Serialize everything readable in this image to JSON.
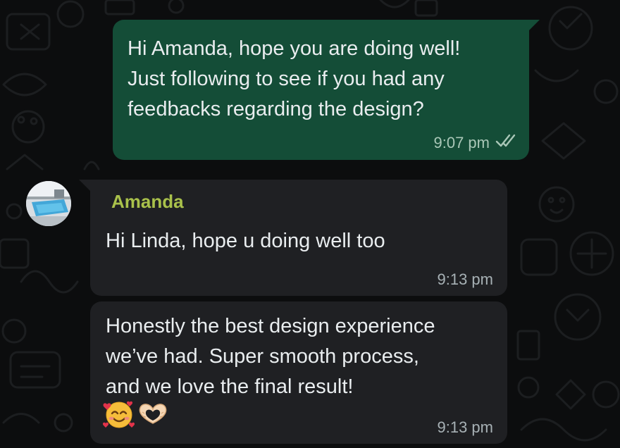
{
  "chat": {
    "messages": [
      {
        "direction": "outgoing",
        "text": "Hi Amanda, hope you are doing well!\nJust following to see if you had any\nfeedbacks regarding the design?",
        "time": "9:07 pm",
        "status_icon": "double-check-icon"
      },
      {
        "direction": "incoming",
        "sender": "Amanda",
        "text": "Hi Linda, hope u doing well too",
        "time": "9:13 pm"
      },
      {
        "direction": "incoming",
        "text": "Honestly the best design experience\nwe’ve had. Super smooth process,\nand we love the final result!",
        "emojis": [
          "smiling-face-with-hearts-emoji",
          "heart-hands-emoji"
        ],
        "time": "9:13 pm"
      }
    ]
  },
  "colors": {
    "background": "#0c0d0e",
    "outgoing_bubble": "#144d37",
    "incoming_bubble": "#1f2023",
    "sender_name": "#a9c14b",
    "text": "#e9edef",
    "timestamp": "#a7b1b5"
  }
}
